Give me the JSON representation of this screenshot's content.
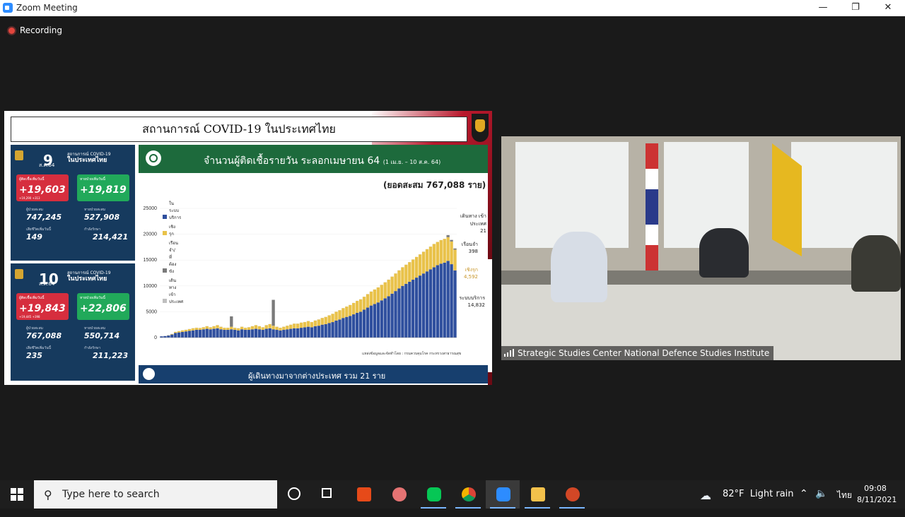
{
  "window": {
    "title": "Zoom Meeting",
    "minimize_icon": "minimize-icon",
    "maximize_icon": "restore-icon",
    "close_icon": "close-icon"
  },
  "recording": {
    "label": "Recording"
  },
  "slide": {
    "title": "สถานการณ์ COVID-19 ในประเทศไทย",
    "card1": {
      "day": "9",
      "month": "ส.ค.64",
      "header_small": "สถานการณ์ COVID-19",
      "header_big": "ในประเทศไทย",
      "new_cases_label": "ผู้ติดเชื้อเพิ่มวันนี้",
      "new_cases": "+19,603",
      "new_cases_sub": "+19,290    +313",
      "recovered_label": "หายป่วยเพิ่มวันนี้",
      "recovered": "+19,819",
      "cum_cases_label": "ผู้ป่วยสะสม",
      "cum_cases": "747,245",
      "cum_recovered_label": "หายป่วยสะสม",
      "cum_recovered": "527,908",
      "deaths_label": "เสียชีวิตเพิ่มวันนี้",
      "deaths": "149",
      "treating_label": "กำลังรักษา",
      "treating": "214,421"
    },
    "card2": {
      "day": "10",
      "month": "ส.ค.64",
      "header_small": "สถานการณ์ COVID-19",
      "header_big": "ในประเทศไทย",
      "new_cases_label": "ผู้ติดเชื้อเพิ่มวันนี้",
      "new_cases": "+19,843",
      "new_cases_sub": "+19,445    +398",
      "recovered_label": "หายป่วยเพิ่มวันนี้",
      "recovered": "+22,806",
      "cum_cases_label": "ผู้ป่วยสะสม",
      "cum_cases": "767,088",
      "cum_recovered_label": "หายป่วยสะสม",
      "cum_recovered": "550,714",
      "deaths_label": "เสียชีวิตเพิ่มวันนี้",
      "deaths": "235",
      "treating_label": "กำลังรักษา",
      "treating": "211,223"
    },
    "chart_panel": {
      "heading": "จำนวนผู้ติดเชื้อรายวัน ระลอกเมษายน 64",
      "heading_range": "(1 เม.ย. – 10 ส.ค. 64)",
      "cumulative": "(ยอดสะสม 767,088 ราย)",
      "source": "แหล่งข้อมูลและจัดทำโดย : กรมควบคุมโรค กระทรวงสาธารณสุข",
      "footer": "ผู้เดินทางมาจากต่างประเทศ รวม 21 ราย",
      "side_labels": [
        {
          "label": "เดินทาง เข้าประเทศ",
          "value": "21"
        },
        {
          "label": "เรือนจำ",
          "value": "398"
        },
        {
          "label": "เชิงรุก",
          "value": "4,592"
        },
        {
          "label": "ระบบบริการ",
          "value": "14,832"
        }
      ]
    }
  },
  "chart_data": {
    "type": "bar",
    "stacked": true,
    "ylim": [
      0,
      25000
    ],
    "yticks": [
      "0",
      "5000",
      "10000",
      "15000",
      "20000",
      "25000"
    ],
    "legend": [
      "ในระบบบริการ",
      "เชิงรุก",
      "เรือนจำ/ที่ต้องขัง",
      "เดินทางเข้าประเทศ"
    ],
    "colors": {
      "service": "#2f4f9e",
      "active": "#e9c24a",
      "prison": "#7a7a7a",
      "travel": "#bfbfbf"
    },
    "series": [
      {
        "name": "ในระบบบริการ",
        "values": [
          250,
          300,
          400,
          600,
          900,
          1000,
          1100,
          1200,
          1300,
          1400,
          1500,
          1500,
          1600,
          1700,
          1600,
          1700,
          1800,
          1600,
          1500,
          1500,
          1600,
          1500,
          1400,
          1600,
          1500,
          1500,
          1600,
          1700,
          1600,
          1500,
          1700,
          1800,
          1600,
          1500,
          1400,
          1500,
          1600,
          1700,
          1800,
          1800,
          1900,
          2000,
          2100,
          2000,
          2200,
          2300,
          2500,
          2600,
          2800,
          3000,
          3300,
          3500,
          3800,
          4000,
          4200,
          4500,
          4800,
          5000,
          5400,
          5800,
          6200,
          6500,
          6800,
          7200,
          7600,
          8000,
          8500,
          9000,
          9500,
          10000,
          10400,
          10800,
          11200,
          11600,
          12000,
          12400,
          12800,
          13200,
          13600,
          14000,
          14300,
          14500,
          14832,
          14200,
          13000
        ]
      },
      {
        "name": "เชิงรุก",
        "values": [
          0,
          0,
          50,
          100,
          200,
          250,
          300,
          300,
          350,
          400,
          400,
          350,
          400,
          500,
          400,
          500,
          600,
          500,
          400,
          400,
          500,
          400,
          400,
          500,
          400,
          500,
          600,
          700,
          600,
          500,
          700,
          800,
          700,
          600,
          500,
          600,
          700,
          800,
          900,
          900,
          1000,
          1000,
          1100,
          1000,
          1100,
          1200,
          1300,
          1400,
          1500,
          1600,
          1700,
          1800,
          1900,
          2000,
          2100,
          2200,
          2300,
          2400,
          2500,
          2600,
          2700,
          2800,
          2900,
          3000,
          3100,
          3200,
          3300,
          3400,
          3500,
          3600,
          3700,
          3800,
          3900,
          4000,
          4100,
          4200,
          4300,
          4400,
          4500,
          4500,
          4550,
          4600,
          4592,
          4400,
          4000
        ]
      },
      {
        "name": "เรือนจำ/ที่ต้องขัง",
        "values": [
          0,
          0,
          0,
          0,
          0,
          0,
          0,
          0,
          0,
          0,
          0,
          0,
          0,
          0,
          0,
          0,
          0,
          0,
          0,
          0,
          2000,
          0,
          0,
          0,
          0,
          0,
          0,
          0,
          0,
          0,
          0,
          0,
          5000,
          0,
          0,
          0,
          0,
          0,
          0,
          0,
          0,
          0,
          0,
          0,
          0,
          0,
          0,
          0,
          0,
          0,
          0,
          0,
          0,
          0,
          0,
          0,
          0,
          0,
          0,
          0,
          0,
          0,
          0,
          0,
          0,
          0,
          0,
          0,
          0,
          0,
          0,
          0,
          0,
          0,
          0,
          0,
          0,
          0,
          0,
          0,
          0,
          0,
          398,
          300,
          250
        ]
      },
      {
        "name": "เดินทางเข้าประเทศ",
        "values": [
          20,
          20,
          20,
          20,
          20,
          20,
          20,
          20,
          20,
          20,
          20,
          20,
          20,
          20,
          20,
          20,
          20,
          20,
          20,
          20,
          20,
          20,
          20,
          20,
          20,
          20,
          20,
          20,
          20,
          20,
          20,
          20,
          20,
          20,
          20,
          20,
          20,
          20,
          20,
          20,
          20,
          20,
          20,
          20,
          20,
          20,
          20,
          20,
          20,
          20,
          20,
          20,
          20,
          20,
          20,
          20,
          20,
          20,
          20,
          20,
          20,
          20,
          20,
          20,
          20,
          20,
          20,
          20,
          20,
          20,
          20,
          20,
          20,
          20,
          20,
          20,
          20,
          20,
          20,
          20,
          20,
          20,
          21,
          20,
          20
        ]
      }
    ]
  },
  "video": {
    "name": "Strategic Studies Center National Defence Studies Institute",
    "signal_icon": "signal-strength-icon"
  },
  "taskbar": {
    "search_placeholder": "Type here to search",
    "apps": [
      "cortana-icon",
      "task-view-icon",
      "office-icon",
      "snipping-icon",
      "line-icon",
      "chrome-icon",
      "zoom-icon",
      "file-explorer-icon",
      "powerpoint-icon"
    ],
    "weather": "82°F  Light rain",
    "language": "ไทย",
    "time": "09:08",
    "date": "8/11/2021"
  }
}
